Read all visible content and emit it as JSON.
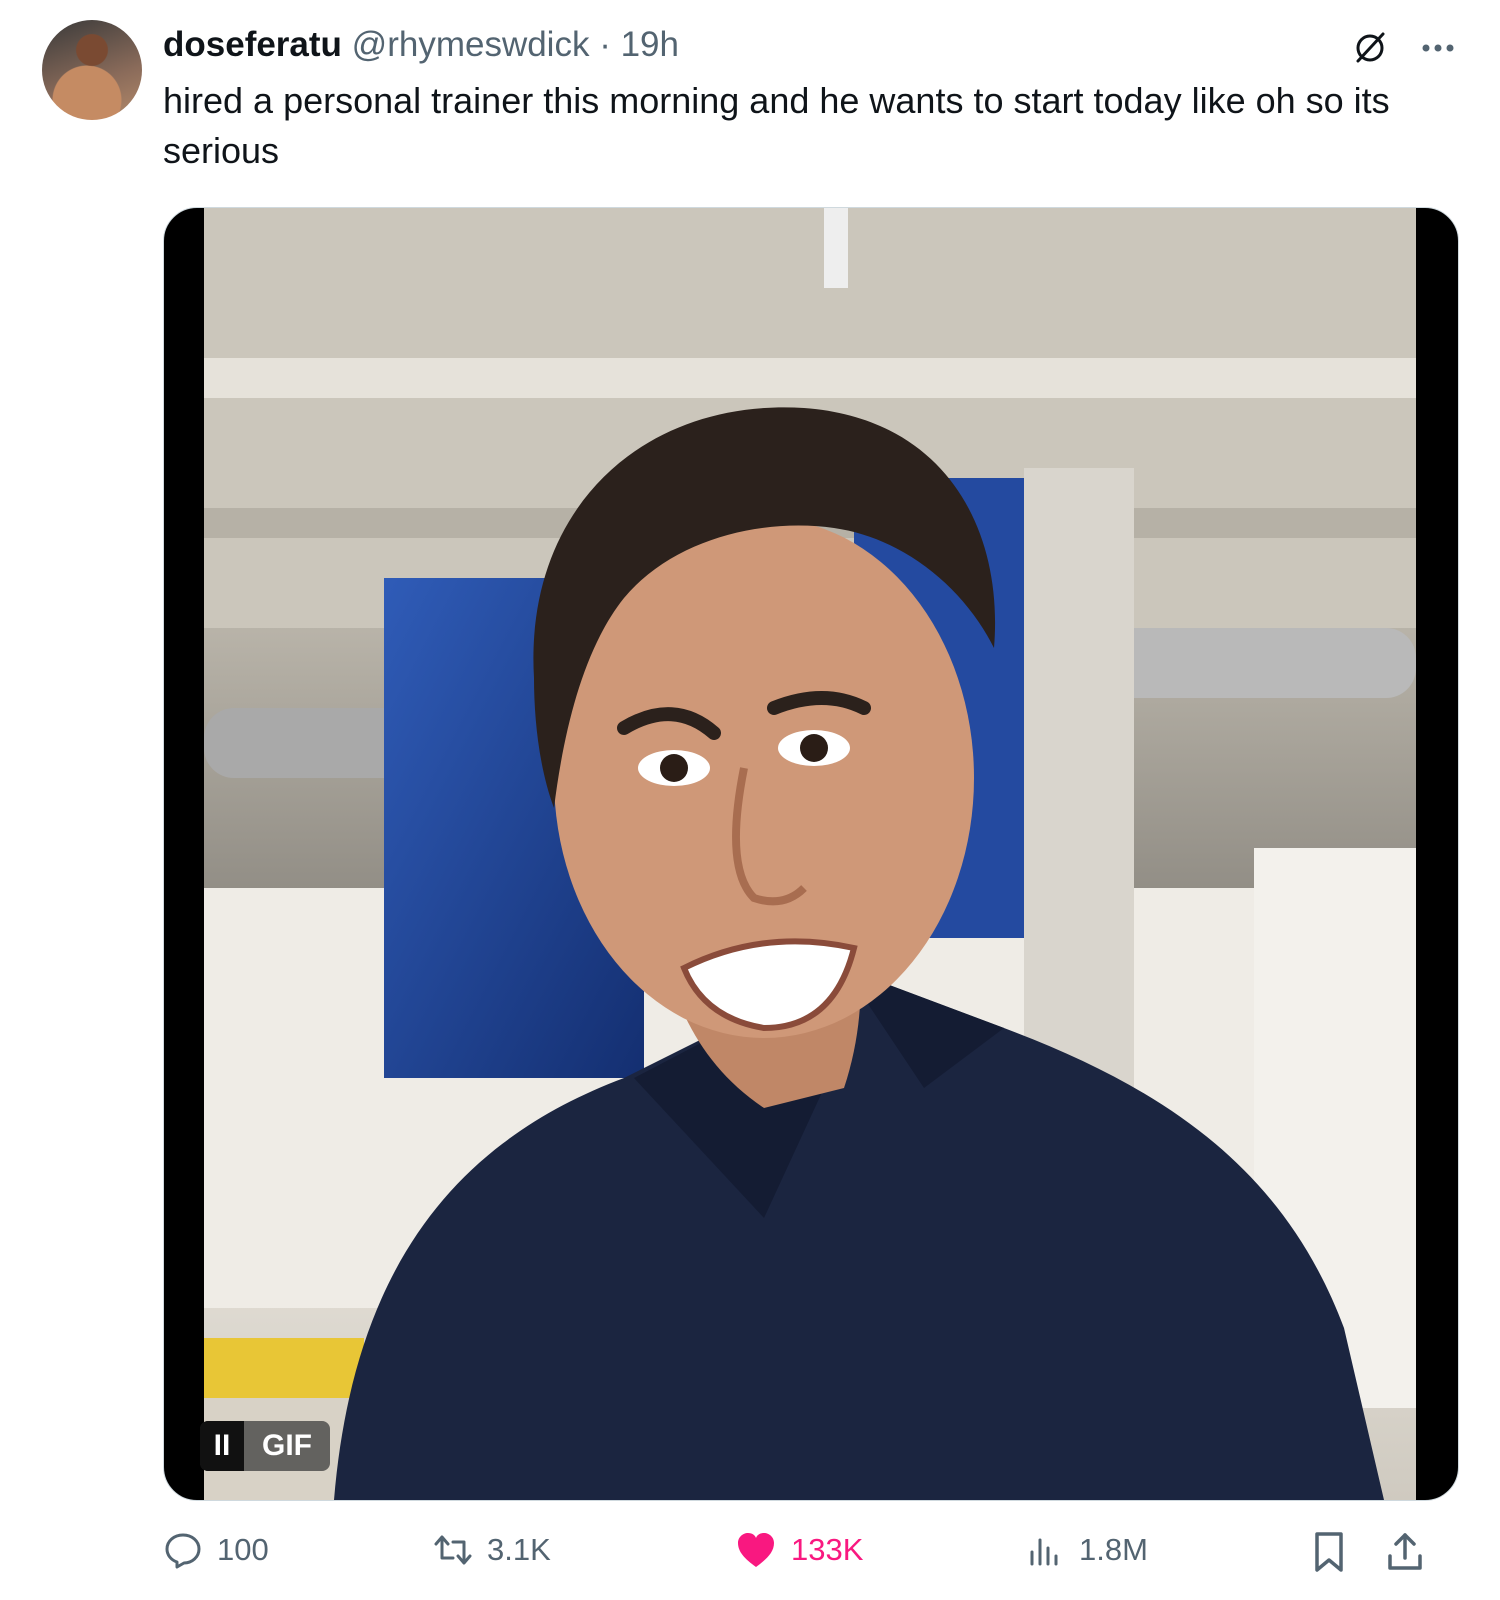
{
  "tweet": {
    "display_name": "doseferatu",
    "handle": "@rhymeswdick",
    "separator": "·",
    "time": "19h",
    "text": "hired a personal trainer this morning and he wants to start today like oh so its serious"
  },
  "media": {
    "badge_pause": "II",
    "badge_label": "GIF"
  },
  "actions": {
    "replies": "100",
    "reposts": "3.1K",
    "likes": "133K",
    "views": "1.8M"
  },
  "colors": {
    "text": "#0f1419",
    "secondary": "#536471",
    "like": "#f91880"
  },
  "icons": {
    "grok": "slashed-circle-icon",
    "more": "more-icon",
    "reply": "reply-icon",
    "repost": "repost-icon",
    "like": "heart-icon",
    "views": "views-icon",
    "bookmark": "bookmark-icon",
    "share": "share-icon"
  }
}
